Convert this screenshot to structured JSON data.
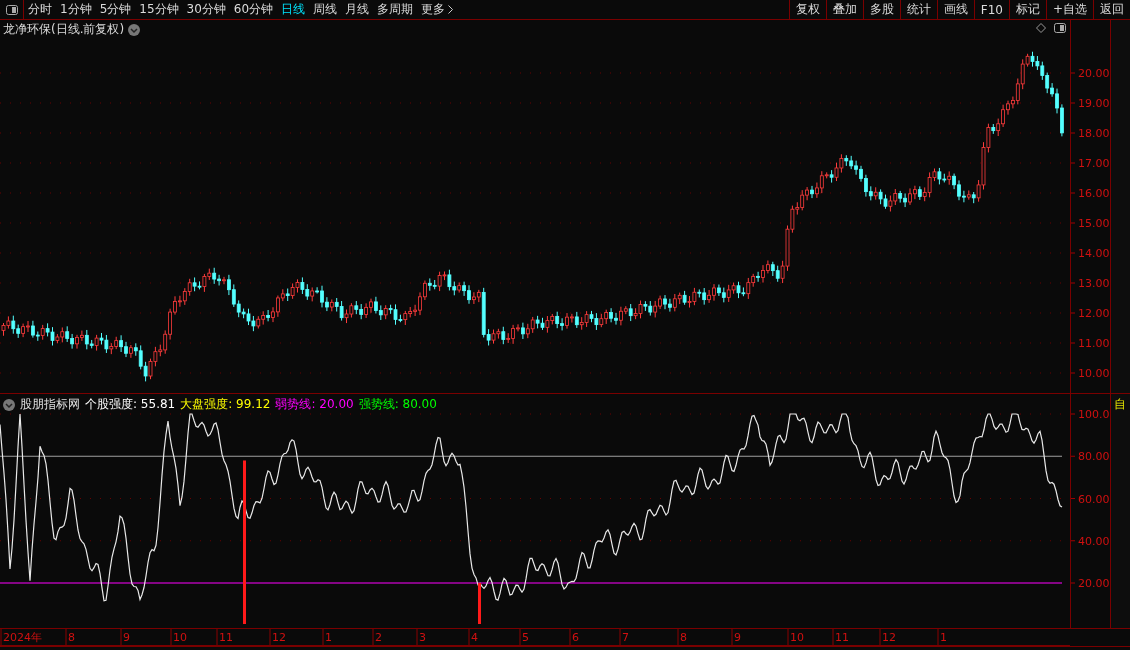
{
  "toolbar": {
    "periods": [
      {
        "label": "分时",
        "selected": false
      },
      {
        "label": "1分钟",
        "selected": false
      },
      {
        "label": "5分钟",
        "selected": false
      },
      {
        "label": "15分钟",
        "selected": false
      },
      {
        "label": "30分钟",
        "selected": false
      },
      {
        "label": "60分钟",
        "selected": false
      },
      {
        "label": "日线",
        "selected": true
      },
      {
        "label": "周线",
        "selected": false
      },
      {
        "label": "月线",
        "selected": false
      },
      {
        "label": "多周期",
        "selected": false
      },
      {
        "label": "更多",
        "selected": false
      }
    ],
    "actions": [
      "复权",
      "叠加",
      "多股",
      "统计",
      "画线",
      "F10",
      "标记",
      "+自选",
      "返回"
    ]
  },
  "price_chart": {
    "title": "龙净环保(日线.前复权)",
    "y_ticks": [
      "20.00",
      "19.00",
      "18.00",
      "17.00",
      "16.00",
      "15.00",
      "14.00",
      "13.00",
      "12.00",
      "11.00",
      "10.00"
    ]
  },
  "indicator": {
    "name": "股朋指标网",
    "readouts": [
      {
        "text": "个股强度: 55.81",
        "color": "#ffffff"
      },
      {
        "text": "大盘强度: 99.12",
        "color": "#ffff00"
      },
      {
        "text": "弱势线: 20.00",
        "color": "#ff00ff"
      },
      {
        "text": "强势线: 80.00",
        "color": "#00ff00"
      }
    ],
    "y_ticks": [
      "100.0",
      "80.00",
      "60.00",
      "40.00",
      "20.00"
    ]
  },
  "date_axis": {
    "labels": [
      "2024年",
      "8",
      "9",
      "10",
      "11",
      "12",
      "1",
      "2",
      "3",
      "4",
      "5",
      "6",
      "7",
      "8",
      "9",
      "10",
      "11",
      "12",
      "1"
    ]
  },
  "side_strip": {
    "label": "自"
  }
}
